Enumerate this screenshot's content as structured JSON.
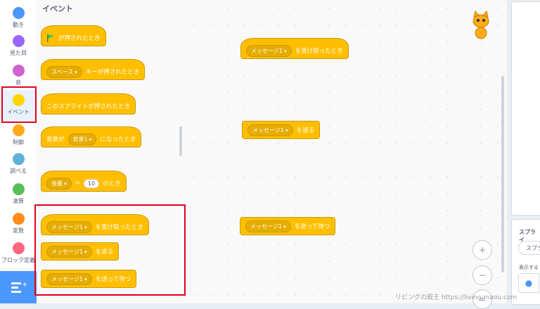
{
  "categories": [
    {
      "label": "動き",
      "color": "#4c97ff"
    },
    {
      "label": "見た目",
      "color": "#9966ff"
    },
    {
      "label": "音",
      "color": "#cf63cf"
    },
    {
      "label": "イベント",
      "color": "#ffd500"
    },
    {
      "label": "制御",
      "color": "#ffab19"
    },
    {
      "label": "調べる",
      "color": "#5cb1d6"
    },
    {
      "label": "演算",
      "color": "#59c059"
    },
    {
      "label": "変数",
      "color": "#ff8c1a"
    },
    {
      "label": "ブロック定義",
      "color": "#ff6680"
    }
  ],
  "palette": {
    "title": "イベント",
    "b1": {
      "text": "が押されたとき"
    },
    "b2": {
      "key": "スペース",
      "text": "キーが押されたとき"
    },
    "b3": {
      "text": "このスプライトが押されたとき"
    },
    "b4": {
      "pre": "背景が",
      "drop": "背景1",
      "text": "になったとき"
    },
    "b5": {
      "drop": "音量",
      "op": ">",
      "num": "10",
      "text": "のとき"
    },
    "b6": {
      "drop": "メッセージ1",
      "text": "を受け取ったとき"
    },
    "b7": {
      "drop": "メッセージ1",
      "text": "を送る"
    },
    "b8": {
      "drop": "メッセージ1",
      "text": "を送って待つ"
    }
  },
  "workspace": {
    "w1": {
      "drop": "メッセージ1",
      "text": "を受け取ったとき"
    },
    "w2": {
      "drop": "メッセージ1",
      "text": "を送る"
    },
    "w3": {
      "drop": "メッセージ1",
      "text": "を送って待つ"
    }
  },
  "zoom": {
    "in": "+",
    "out": "−",
    "reset": "="
  },
  "sprite_panel": {
    "title": "スプライ",
    "name": "スプラ",
    "show": "表示する"
  },
  "icons": {
    "extension": "extension-icon",
    "flag": "green-flag-icon",
    "eye": "eye-icon"
  },
  "watermark": "リビングの殿王 https://living-maou.com"
}
